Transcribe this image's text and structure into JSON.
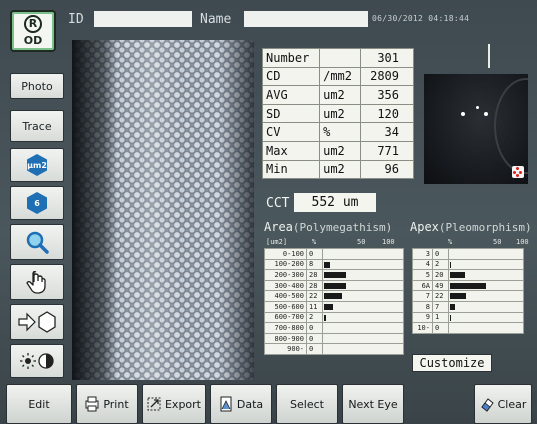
{
  "header": {
    "eye_label": "OD",
    "eye_letter": "R",
    "id_label": "ID",
    "id_value": "",
    "name_label": "Name",
    "name_value": "",
    "datetime": "06/30/2012 04:18:44"
  },
  "toolbar": {
    "photo_label": "Photo",
    "trace_label": "Trace",
    "um2_label": "μm2",
    "six_label": "6"
  },
  "stats": [
    {
      "label": "Number",
      "unit": "",
      "value": "301"
    },
    {
      "label": "CD",
      "unit": "/mm2",
      "value": "2809"
    },
    {
      "label": "AVG",
      "unit": "um2",
      "value": "356"
    },
    {
      "label": "SD",
      "unit": "um2",
      "value": "120"
    },
    {
      "label": "CV",
      "unit": "%",
      "value": "34"
    },
    {
      "label": "Max",
      "unit": "um2",
      "value": "771"
    },
    {
      "label": "Min",
      "unit": "um2",
      "value": "96"
    }
  ],
  "cct": {
    "label": "CCT",
    "value": "552 um"
  },
  "area_hist": {
    "title": "Area",
    "subtitle": "(Polymegathism)",
    "unit": "[um2]",
    "pct_symbol": "%",
    "scale_50": "50",
    "scale_100": "100",
    "rows": [
      {
        "range": "0-100",
        "pct": 0
      },
      {
        "range": "100-200",
        "pct": 8
      },
      {
        "range": "200-300",
        "pct": 28
      },
      {
        "range": "300-400",
        "pct": 28
      },
      {
        "range": "400-500",
        "pct": 22
      },
      {
        "range": "500-600",
        "pct": 11
      },
      {
        "range": "600-700",
        "pct": 2
      },
      {
        "range": "700-800",
        "pct": 0
      },
      {
        "range": "800-900",
        "pct": 0
      },
      {
        "range": "900-",
        "pct": 0
      }
    ]
  },
  "apex_hist": {
    "title": "Apex",
    "subtitle": "(Pleomorphism)",
    "pct_symbol": "%",
    "scale_50": "50",
    "scale_100": "100",
    "rows": [
      {
        "apex": "3",
        "pct": 0
      },
      {
        "apex": "4",
        "pct": 2
      },
      {
        "apex": "5",
        "pct": 20
      },
      {
        "apex": "6A",
        "pct": 49
      },
      {
        "apex": "7",
        "pct": 22
      },
      {
        "apex": "8",
        "pct": 7
      },
      {
        "apex": "9",
        "pct": 1
      },
      {
        "apex": "10-",
        "pct": 0
      }
    ]
  },
  "customize_label": "Customize",
  "bottom": {
    "edit": "Edit",
    "print": "Print",
    "export": "Export",
    "data": "Data",
    "select": "Select",
    "next_eye": "Next Eye",
    "clear": "Clear"
  },
  "colors": {
    "accent_blue": "#1f6fb5",
    "badge_green": "#7cc08a",
    "marker_red": "#e0201c"
  }
}
